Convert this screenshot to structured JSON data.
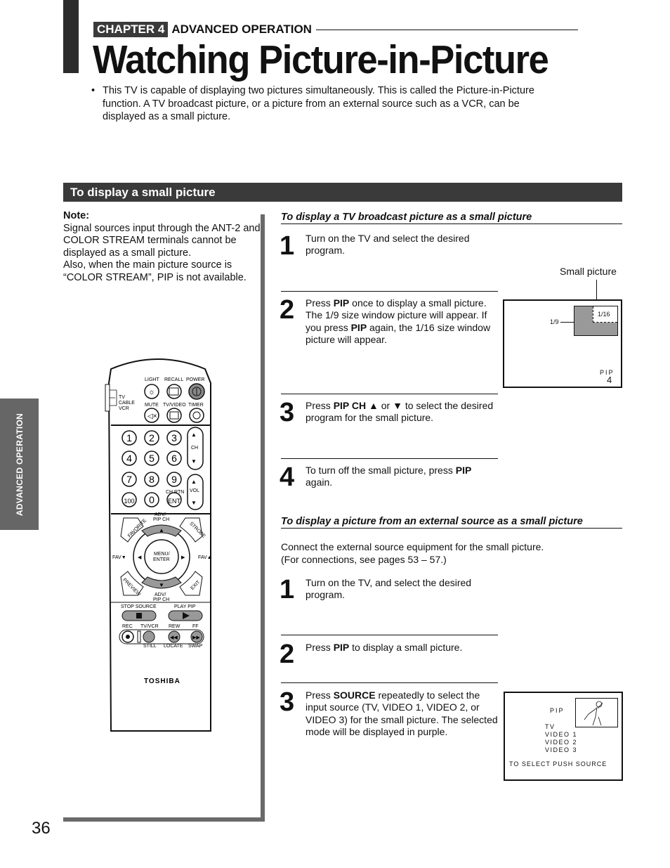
{
  "header": {
    "chapter_badge": "CHAPTER 4",
    "chapter_title": "ADVANCED OPERATION",
    "page_title": "Watching Picture-in-Picture"
  },
  "intro": {
    "bullet": "•",
    "text": "This TV is capable of displaying two pictures simultaneously. This is called the Picture-in-Picture function. A TV broadcast picture, or a picture from an external source such as a VCR, can be displayed as a small picture."
  },
  "section": {
    "title": "To display a small picture"
  },
  "note": {
    "label": "Note:",
    "lines": [
      "Signal sources input through the ANT-2 and COLOR STREAM terminals cannot be displayed as a small picture.",
      "Also, when the main picture source is “COLOR STREAM”, PIP is not available."
    ]
  },
  "side_tab": {
    "label": "ADVANCED OPERATION"
  },
  "page_number": "36",
  "broadcast": {
    "heading": "To display a TV broadcast picture as a small picture",
    "steps": [
      {
        "num": "1",
        "parts": [
          {
            "t": "Turn on the TV and select the desired program."
          }
        ]
      },
      {
        "num": "2",
        "parts": [
          {
            "t": "Press "
          },
          {
            "b": "PIP"
          },
          {
            "t": " once to display a small picture. The 1/9 size window picture will appear. If you press "
          },
          {
            "b": "PIP"
          },
          {
            "t": " again, the 1/16 size window picture will appear."
          }
        ]
      },
      {
        "num": "3",
        "parts": [
          {
            "t": "Press "
          },
          {
            "b": "PIP CH"
          },
          {
            "t": "  ▲  or  ▼  to select the desired program for the small picture."
          }
        ]
      },
      {
        "num": "4",
        "parts": [
          {
            "t": "To turn off the small picture, press "
          },
          {
            "b": "PIP"
          },
          {
            "t": " again."
          }
        ]
      }
    ],
    "diagram": {
      "caption": "Small picture",
      "label_large": "1/9",
      "label_small": "1/16",
      "osd_label": "PIP",
      "osd_channel": "4"
    }
  },
  "external": {
    "heading": "To display a picture from an external source as a small picture",
    "intro_lines": [
      "Connect the external source equipment for the small picture.",
      "(For connections, see pages 53 – 57.)"
    ],
    "steps": [
      {
        "num": "1",
        "parts": [
          {
            "t": "Turn on the TV, and select the desired program."
          }
        ]
      },
      {
        "num": "2",
        "parts": [
          {
            "t": "Press "
          },
          {
            "b": "PIP"
          },
          {
            "t": " to display a small picture."
          }
        ]
      },
      {
        "num": "3",
        "parts": [
          {
            "t": "Press "
          },
          {
            "b": "SOURCE"
          },
          {
            "t": " repeatedly to select the input source (TV, VIDEO 1, VIDEO 2, or VIDEO 3) for the small picture. The selected mode will be displayed in purple."
          }
        ]
      }
    ],
    "osd": {
      "title": "PIP",
      "options": [
        "TV",
        "VIDEO 1",
        "VIDEO 2",
        "VIDEO 3"
      ],
      "footer": "TO SELECT PUSH SOURCE"
    }
  },
  "remote": {
    "mode_switch": [
      "TV",
      "CABLE",
      "VCR"
    ],
    "top_labels": [
      "LIGHT",
      "RECALL",
      "POWER"
    ],
    "mid_labels": [
      "MUTE",
      "TV/VIDEO",
      "TIMER"
    ],
    "digits": [
      "1",
      "2",
      "3",
      "4",
      "5",
      "6",
      "7",
      "8",
      "9",
      "100",
      "0",
      "ENT"
    ],
    "ch_label": "CH",
    "vol_label": "VOL",
    "ch_rtn_label": "CH RTN",
    "adv_top": "ADV/\nPIP CH",
    "adv_bottom": "ADV/\nPIP CH",
    "favorite": "FAVORITE",
    "strobe": "STROBE",
    "preview": "PREVIEW",
    "exit": "EXIT",
    "fav_down": "FAV▼",
    "fav_up": "FAV▲",
    "menu": "MENU/\nENTER",
    "stop_source": "STOP SOURCE",
    "play_pip": "PLAY PIP",
    "transport_labels_top": [
      "REC",
      "TV/VCR",
      "REW",
      "FF"
    ],
    "transport_labels_bottom": [
      "STILL",
      "LOCATE",
      "SWAP"
    ],
    "brand": "TOSHIBA"
  }
}
